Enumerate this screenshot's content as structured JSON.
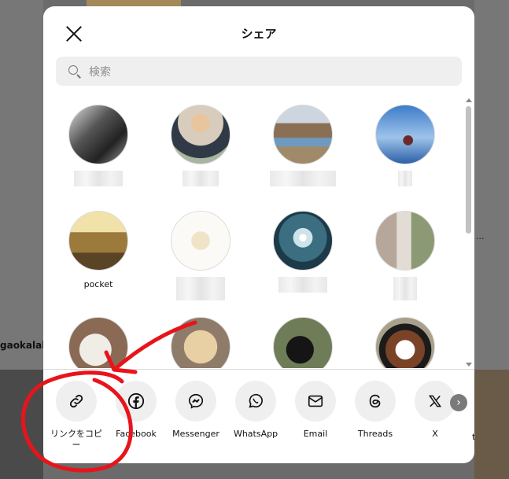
{
  "background": {
    "left_text": "gaokalab",
    "right_text": "..."
  },
  "dialog": {
    "title": "シェア",
    "search_placeholder": "検索"
  },
  "users": [
    {
      "name": "",
      "avatar_color": "#555555"
    },
    {
      "name": "",
      "avatar_color": "#d9c8b4"
    },
    {
      "name": "",
      "avatar_color": "#9a8a6c"
    },
    {
      "name": "",
      "avatar_color": "#6aa0d8"
    },
    {
      "name": "pocket",
      "avatar_color": "#b58a3a"
    },
    {
      "name": "",
      "avatar_color": "#f4f0ea"
    },
    {
      "name": "",
      "avatar_color": "#2c5c6e"
    },
    {
      "name": "",
      "avatar_color": "#c9bdb0"
    },
    {
      "name": "",
      "avatar_color": "#c0a28c"
    },
    {
      "name": "",
      "avatar_color": "#cfb893"
    },
    {
      "name": "",
      "avatar_color": "#5c6a4a"
    },
    {
      "name": "",
      "avatar_color": "#6a4a36"
    }
  ],
  "share_targets": [
    {
      "label": "リンクをコピー",
      "icon": "link-icon"
    },
    {
      "label": "Facebook",
      "icon": "facebook-icon"
    },
    {
      "label": "Messenger",
      "icon": "messenger-icon"
    },
    {
      "label": "WhatsApp",
      "icon": "whatsapp-icon"
    },
    {
      "label": "Email",
      "icon": "email-icon"
    },
    {
      "label": "Threads",
      "icon": "threads-icon"
    },
    {
      "label": "X",
      "icon": "x-icon"
    }
  ],
  "next_glyph": "›",
  "cut_label": "t",
  "annotation_color": "#e8141b"
}
